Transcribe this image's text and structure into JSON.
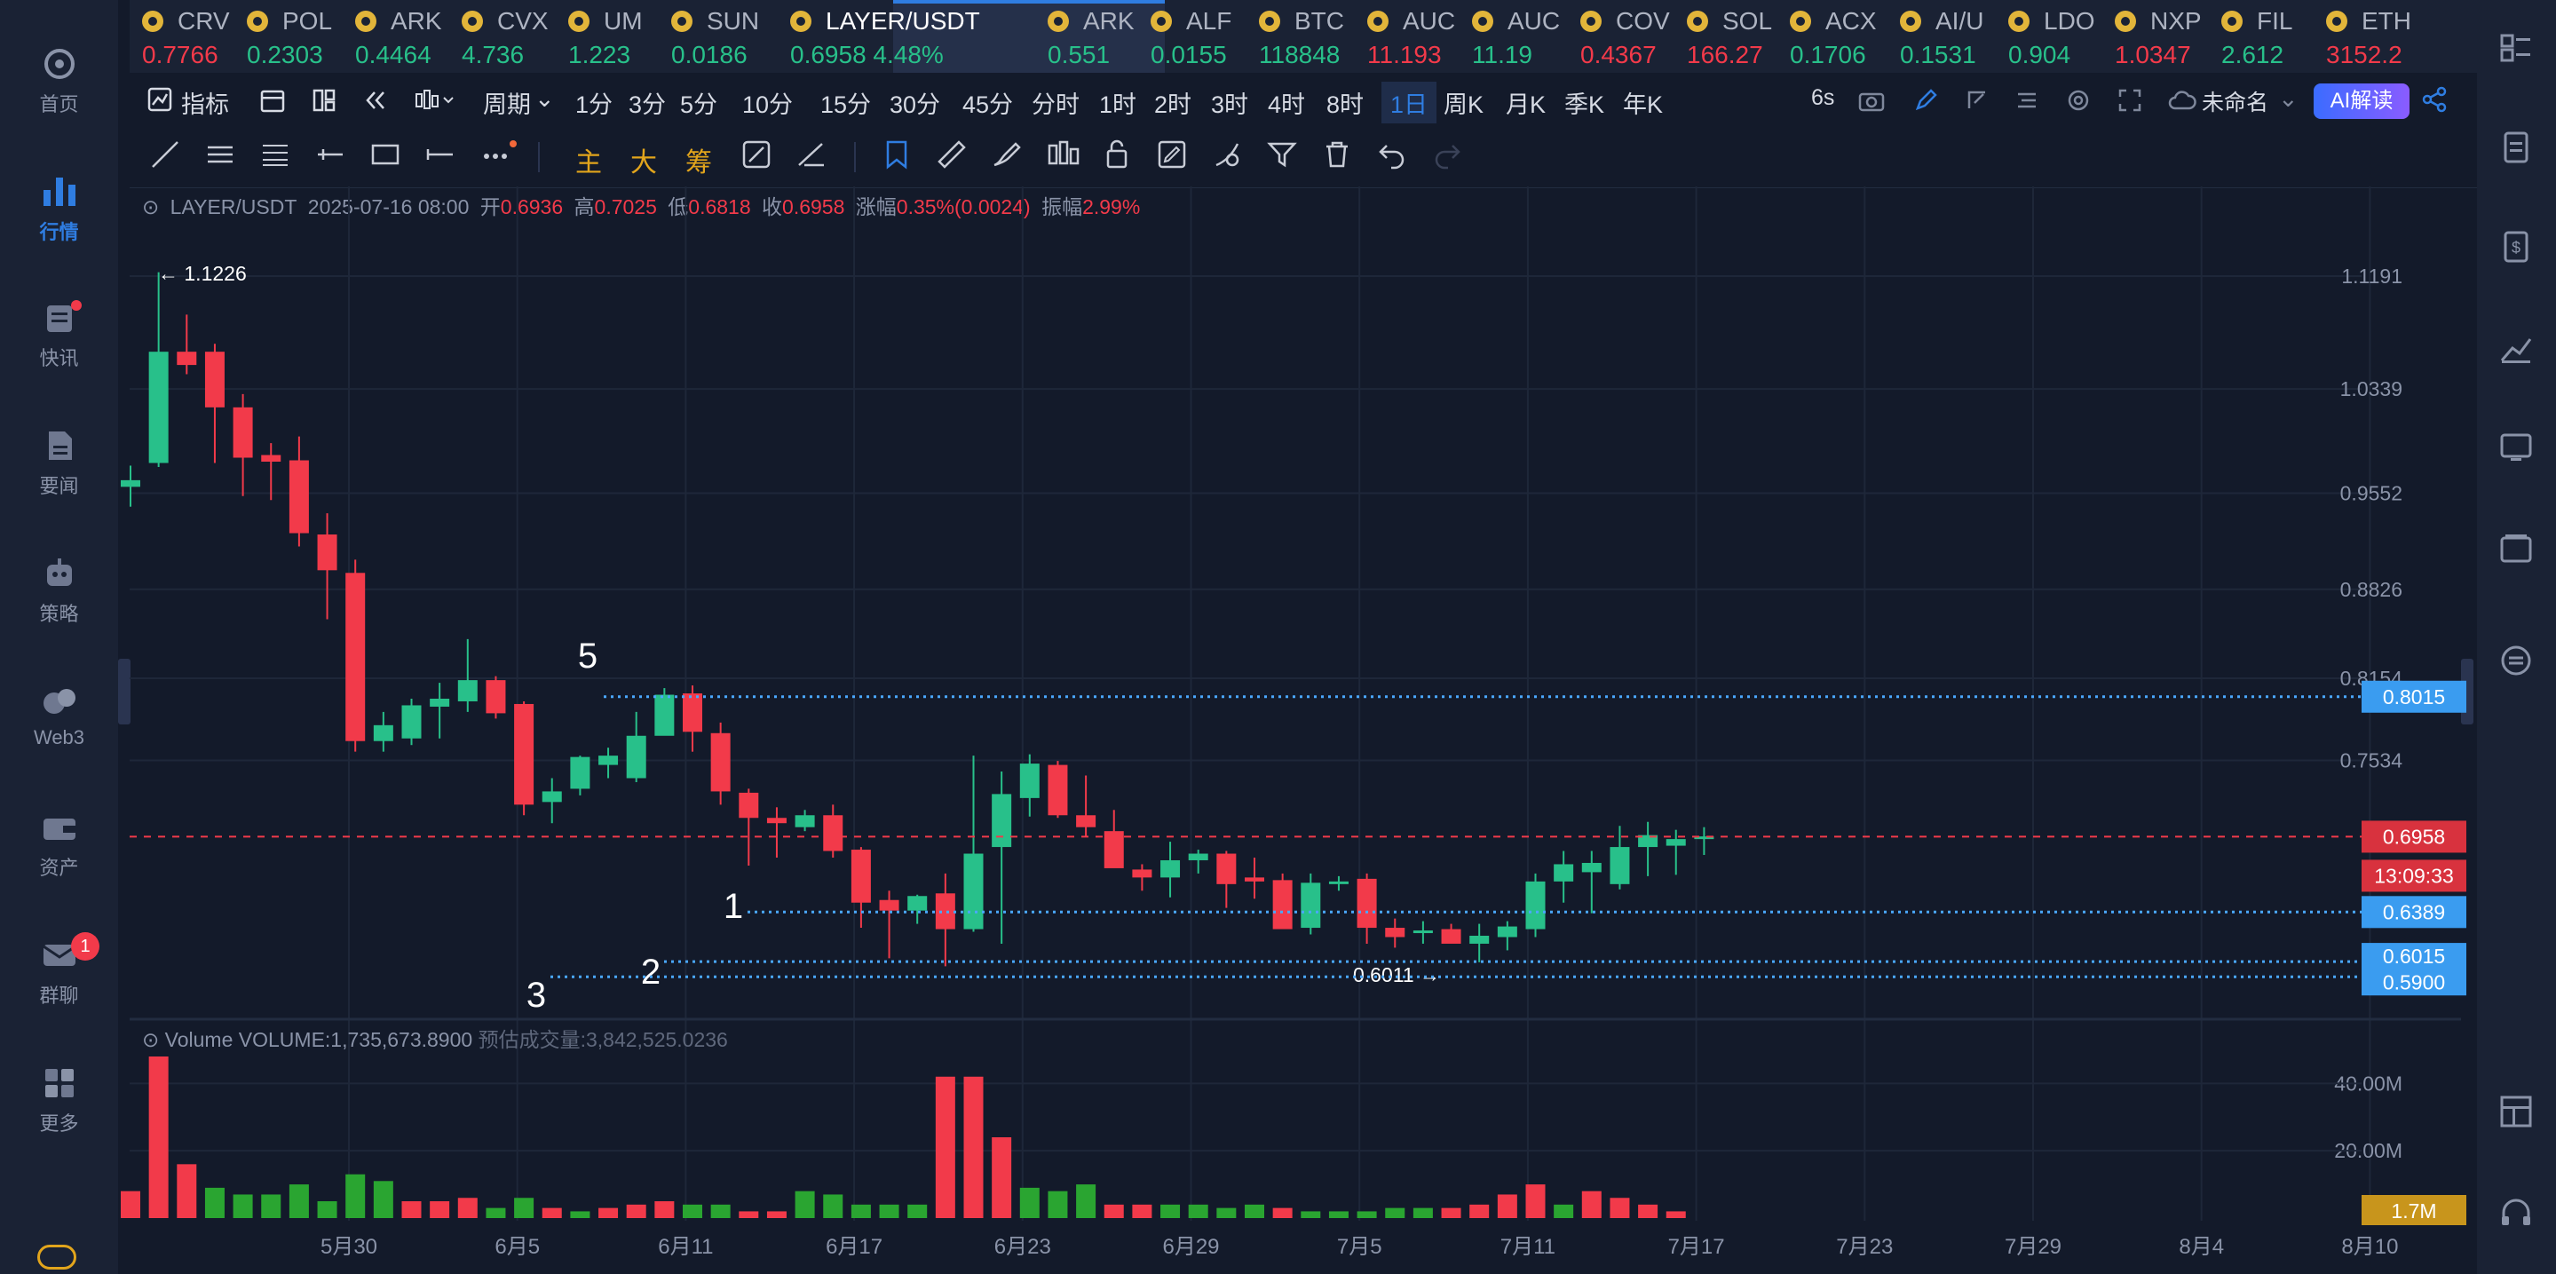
{
  "sidebar": {
    "items": [
      {
        "label": "首页",
        "icon": "home-icon"
      },
      {
        "label": "行情",
        "icon": "market-chart-icon"
      },
      {
        "label": "快讯",
        "icon": "newsflash-icon"
      },
      {
        "label": "要闻",
        "icon": "news-icon"
      },
      {
        "label": "策略",
        "icon": "strategy-robot-icon"
      },
      {
        "label": "Web3",
        "icon": "web3-icon"
      },
      {
        "label": "资产",
        "icon": "wallet-icon"
      },
      {
        "label": "群聊",
        "icon": "group-chat-icon",
        "badge": "1"
      },
      {
        "label": "更多",
        "icon": "grid-more-icon"
      }
    ]
  },
  "tickers": [
    {
      "name": "CRV",
      "price": "0.7766",
      "trend": "down"
    },
    {
      "name": "POL",
      "price": "0.2303",
      "trend": "up"
    },
    {
      "name": "ARK",
      "price": "0.4464",
      "trend": "up"
    },
    {
      "name": "CVX",
      "price": "4.736",
      "trend": "up"
    },
    {
      "name": "UM",
      "price": "1.223",
      "trend": "up"
    },
    {
      "name": "SUN",
      "price": "0.0186",
      "trend": "up"
    },
    {
      "name": "LAYER/USDT",
      "price": "0.6958",
      "change": "4.48%",
      "trend": "up",
      "active": true
    },
    {
      "name": "ARK",
      "price": "0.551",
      "trend": "up"
    },
    {
      "name": "ALF",
      "price": "0.0155",
      "trend": "up"
    },
    {
      "name": "BTC",
      "price": "118848",
      "trend": "up"
    },
    {
      "name": "AUC",
      "price": "11.193",
      "trend": "down"
    },
    {
      "name": "AUC",
      "price": "11.19",
      "trend": "up"
    },
    {
      "name": "COV",
      "price": "0.4367",
      "trend": "down"
    },
    {
      "name": "SOL",
      "price": "166.27",
      "trend": "down"
    },
    {
      "name": "ACX",
      "price": "0.1706",
      "trend": "up"
    },
    {
      "name": "AI/U",
      "price": "0.1531",
      "trend": "up"
    },
    {
      "name": "LDO",
      "price": "0.904",
      "trend": "up"
    },
    {
      "name": "NXP",
      "price": "1.0347",
      "trend": "down"
    },
    {
      "name": "FIL",
      "price": "2.612",
      "trend": "up"
    },
    {
      "name": "ETH",
      "price": "3152.2",
      "trend": "down"
    }
  ],
  "toolbar": {
    "indicator_label": "指标",
    "period_label": "周期",
    "periods": [
      "1分",
      "3分",
      "5分",
      "10分",
      "15分",
      "30分",
      "45分",
      "分时",
      "1时",
      "2时",
      "3时",
      "4时",
      "8时",
      "1日",
      "周K",
      "月K",
      "季K",
      "年K"
    ],
    "selected_period": "1日",
    "refresh_label": "6s",
    "layout_name": "未命名",
    "ai_label": "AI解读"
  },
  "draw_tools": {
    "text_tools": [
      "主",
      "大",
      "筹"
    ]
  },
  "info_bar": {
    "symbol": "LAYER/USDT",
    "date": "2025-07-16 08:00",
    "open_label": "开",
    "open": "0.6936",
    "high_label": "高",
    "high": "0.7025",
    "low_label": "低",
    "low": "0.6818",
    "close_label": "收",
    "close": "0.6958",
    "change_label": "涨幅",
    "change": "0.35%(0.0024)",
    "amp_label": "振幅",
    "amp": "2.99%"
  },
  "volume_info": {
    "title": "Volume",
    "value": "VOLUME:1,735,673.8900",
    "estimate": "预估成交量:3,842,525.0236"
  },
  "chart_data": {
    "type": "candlestick",
    "y_ticks": [
      "1.1191",
      "1.0339",
      "0.9552",
      "0.8826",
      "0.8154",
      "0.7534"
    ],
    "ylim": [
      0.56,
      1.16
    ],
    "x_ticks": [
      "5月30",
      "6月5",
      "6月11",
      "6月17",
      "6月23",
      "6月29",
      "7月5",
      "7月11",
      "7月17",
      "7月23",
      "7月29",
      "8月4",
      "8月10"
    ],
    "high_marker": "1.1226",
    "low_marker": "0.6011",
    "current_price": "0.6958",
    "countdown": "13:09:33",
    "horizontal_levels": [
      {
        "label": "5",
        "price": "0.8015"
      },
      {
        "label": "1",
        "price": "0.6389"
      },
      {
        "label": "2",
        "price": "0.6015"
      },
      {
        "label": "3",
        "price": "0.5900"
      }
    ],
    "candles": [
      [
        0.96,
        0.976,
        0.945,
        0.965
      ],
      [
        0.978,
        1.122,
        0.975,
        1.062
      ],
      [
        1.062,
        1.09,
        1.045,
        1.052
      ],
      [
        1.062,
        1.068,
        0.978,
        1.02
      ],
      [
        1.02,
        1.03,
        0.953,
        0.982
      ],
      [
        0.984,
        0.993,
        0.95,
        0.979
      ],
      [
        0.98,
        0.998,
        0.915,
        0.925
      ],
      [
        0.924,
        0.94,
        0.86,
        0.897
      ],
      [
        0.895,
        0.905,
        0.76,
        0.768
      ],
      [
        0.768,
        0.79,
        0.76,
        0.78
      ],
      [
        0.77,
        0.8,
        0.765,
        0.795
      ],
      [
        0.794,
        0.812,
        0.77,
        0.8
      ],
      [
        0.798,
        0.845,
        0.79,
        0.814
      ],
      [
        0.814,
        0.817,
        0.785,
        0.789
      ],
      [
        0.796,
        0.798,
        0.712,
        0.72
      ],
      [
        0.722,
        0.74,
        0.706,
        0.73
      ],
      [
        0.732,
        0.757,
        0.727,
        0.756
      ],
      [
        0.75,
        0.763,
        0.74,
        0.757
      ],
      [
        0.74,
        0.79,
        0.737,
        0.772
      ],
      [
        0.772,
        0.808,
        0.775,
        0.803
      ],
      [
        0.804,
        0.81,
        0.76,
        0.775
      ],
      [
        0.774,
        0.782,
        0.72,
        0.73
      ],
      [
        0.729,
        0.732,
        0.674,
        0.71
      ],
      [
        0.71,
        0.718,
        0.68,
        0.706
      ],
      [
        0.703,
        0.716,
        0.7,
        0.712
      ],
      [
        0.712,
        0.72,
        0.68,
        0.685
      ],
      [
        0.686,
        0.688,
        0.627,
        0.646
      ],
      [
        0.648,
        0.655,
        0.604,
        0.64
      ],
      [
        0.64,
        0.652,
        0.63,
        0.651
      ],
      [
        0.653,
        0.668,
        0.598,
        0.626
      ],
      [
        0.626,
        0.757,
        0.624,
        0.683
      ],
      [
        0.688,
        0.745,
        0.615,
        0.728
      ],
      [
        0.725,
        0.758,
        0.711,
        0.751
      ],
      [
        0.75,
        0.753,
        0.71,
        0.712
      ],
      [
        0.712,
        0.742,
        0.696,
        0.703
      ],
      [
        0.7,
        0.716,
        0.69,
        0.672
      ],
      [
        0.671,
        0.675,
        0.655,
        0.665
      ],
      [
        0.665,
        0.692,
        0.65,
        0.678
      ],
      [
        0.678,
        0.686,
        0.668,
        0.683
      ],
      [
        0.683,
        0.685,
        0.642,
        0.66
      ],
      [
        0.665,
        0.68,
        0.649,
        0.662
      ],
      [
        0.663,
        0.668,
        0.63,
        0.626
      ],
      [
        0.627,
        0.668,
        0.622,
        0.661
      ],
      [
        0.661,
        0.666,
        0.655,
        0.662
      ],
      [
        0.664,
        0.668,
        0.615,
        0.627
      ],
      [
        0.627,
        0.634,
        0.612,
        0.62
      ],
      [
        0.623,
        0.632,
        0.615,
        0.625
      ],
      [
        0.626,
        0.63,
        0.617,
        0.615
      ],
      [
        0.615,
        0.63,
        0.601,
        0.621
      ],
      [
        0.62,
        0.632,
        0.61,
        0.628
      ],
      [
        0.626,
        0.668,
        0.62,
        0.662
      ],
      [
        0.662,
        0.685,
        0.646,
        0.675
      ],
      [
        0.669,
        0.685,
        0.638,
        0.676
      ],
      [
        0.66,
        0.704,
        0.656,
        0.688
      ],
      [
        0.688,
        0.707,
        0.666,
        0.697
      ],
      [
        0.689,
        0.701,
        0.667,
        0.694
      ],
      [
        0.694,
        0.703,
        0.682,
        0.696
      ]
    ],
    "volume_ticks": [
      "40.00M",
      "20.00M"
    ],
    "volume_current": "1.7M",
    "volume_max": 48,
    "volumes": [
      [
        8,
        0
      ],
      [
        48,
        0
      ],
      [
        16,
        0
      ],
      [
        9,
        1
      ],
      [
        7,
        1
      ],
      [
        7,
        1
      ],
      [
        10,
        1
      ],
      [
        5,
        1
      ],
      [
        13,
        1
      ],
      [
        11,
        1
      ],
      [
        5,
        0
      ],
      [
        5,
        0
      ],
      [
        6,
        0
      ],
      [
        3,
        1
      ],
      [
        6,
        1
      ],
      [
        3,
        0
      ],
      [
        2,
        1
      ],
      [
        3,
        0
      ],
      [
        4,
        0
      ],
      [
        5,
        0
      ],
      [
        4,
        1
      ],
      [
        4,
        1
      ],
      [
        2,
        0
      ],
      [
        2,
        0
      ],
      [
        8,
        1
      ],
      [
        7,
        1
      ],
      [
        4,
        1
      ],
      [
        4,
        1
      ],
      [
        4,
        1
      ],
      [
        42,
        0
      ],
      [
        42,
        0
      ],
      [
        24,
        0
      ],
      [
        9,
        1
      ],
      [
        8,
        1
      ],
      [
        10,
        1
      ],
      [
        4,
        0
      ],
      [
        4,
        0
      ],
      [
        4,
        1
      ],
      [
        4,
        1
      ],
      [
        3,
        1
      ],
      [
        4,
        1
      ],
      [
        3,
        0
      ],
      [
        2,
        1
      ],
      [
        2,
        1
      ],
      [
        2,
        1
      ],
      [
        3,
        1
      ],
      [
        3,
        1
      ],
      [
        3,
        0
      ],
      [
        4,
        0
      ],
      [
        7,
        0
      ],
      [
        10,
        0
      ],
      [
        4,
        1
      ],
      [
        8,
        0
      ],
      [
        6,
        0
      ],
      [
        4,
        0
      ],
      [
        2,
        0
      ]
    ]
  },
  "colors": {
    "up": "#28c08a",
    "down": "#f23a4a",
    "accent": "#2f7de1",
    "level_line": "#4aa8ff",
    "background": "#131a2a"
  }
}
